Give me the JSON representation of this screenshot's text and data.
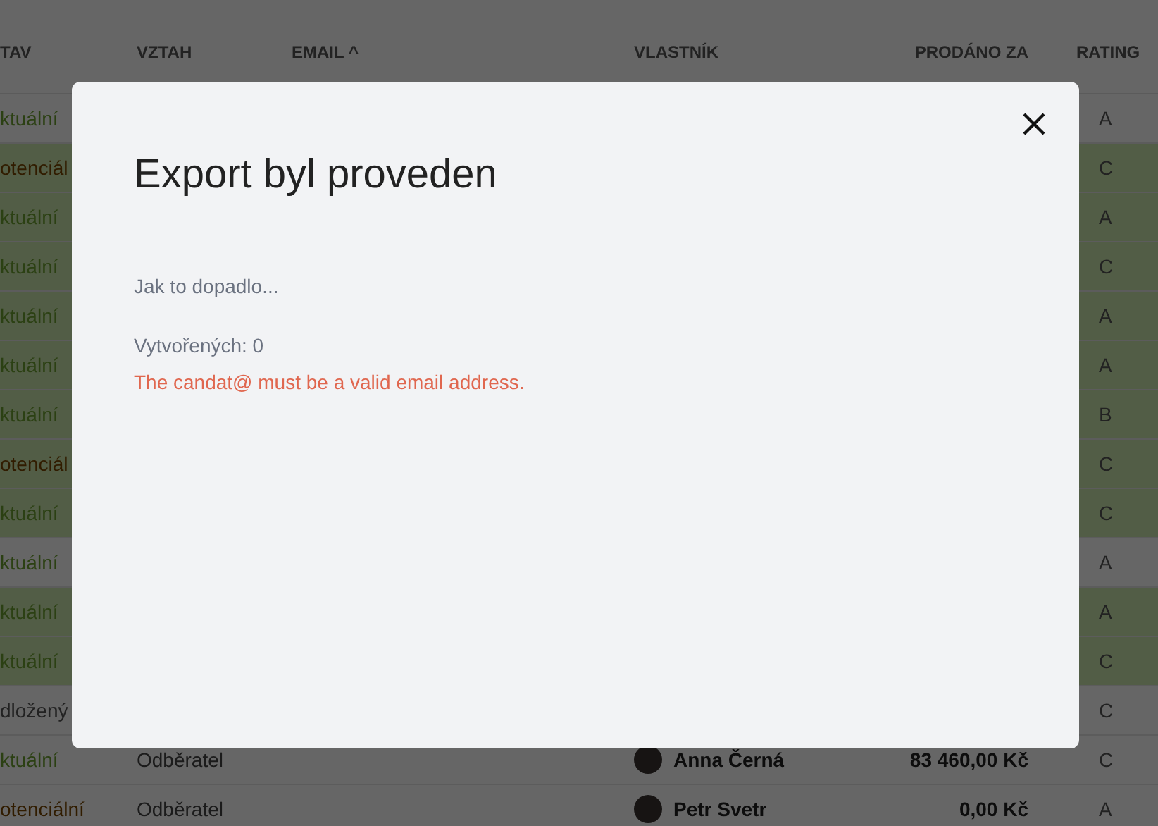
{
  "table": {
    "columns": [
      "TAV",
      "VZTAH",
      "EMAIL ^",
      "VLASTNÍK",
      "PRODÁNO ZA",
      "RATING"
    ],
    "rows": [
      {
        "status": "ktuální",
        "kind": "actual",
        "highlighted": false,
        "rating": "A"
      },
      {
        "status": "otenciál",
        "kind": "potential",
        "highlighted": true,
        "rating": "C"
      },
      {
        "status": "ktuální",
        "kind": "actual",
        "highlighted": true,
        "rating": "A"
      },
      {
        "status": "ktuální",
        "kind": "actual",
        "highlighted": true,
        "rating": "C"
      },
      {
        "status": "ktuální",
        "kind": "actual",
        "highlighted": true,
        "rating": "A"
      },
      {
        "status": "ktuální",
        "kind": "actual",
        "highlighted": true,
        "rating": "A"
      },
      {
        "status": "ktuální",
        "kind": "actual",
        "highlighted": true,
        "rating": "B"
      },
      {
        "status": "otenciál",
        "kind": "potential",
        "highlighted": true,
        "rating": "C"
      },
      {
        "status": "ktuální",
        "kind": "actual",
        "highlighted": true,
        "rating": "C"
      },
      {
        "status": "ktuální",
        "kind": "actual",
        "highlighted": false,
        "rating": "A"
      },
      {
        "status": "ktuální",
        "kind": "actual",
        "highlighted": true,
        "rating": "A"
      },
      {
        "status": "ktuální",
        "kind": "actual",
        "highlighted": true,
        "rating": "C"
      },
      {
        "status": "dložený",
        "kind": "postponed",
        "highlighted": false,
        "rating": "C"
      },
      {
        "status": "ktuální",
        "kind": "actual",
        "highlighted": false,
        "relation": "Odběratel",
        "owner": "Anna Černá",
        "price": "83 460,00 Kč",
        "rating": "C"
      },
      {
        "status": "otenciální",
        "kind": "potential",
        "highlighted": false,
        "relation": "Odběratel",
        "owner": "Petr Svetr",
        "price": "0,00 Kč",
        "rating": "A"
      }
    ]
  },
  "dialog": {
    "title": "Export byl proveden",
    "subtitle": "Jak to dopadlo...",
    "created": "Vytvořených: 0",
    "error": "The candat@ must be a valid email address."
  }
}
